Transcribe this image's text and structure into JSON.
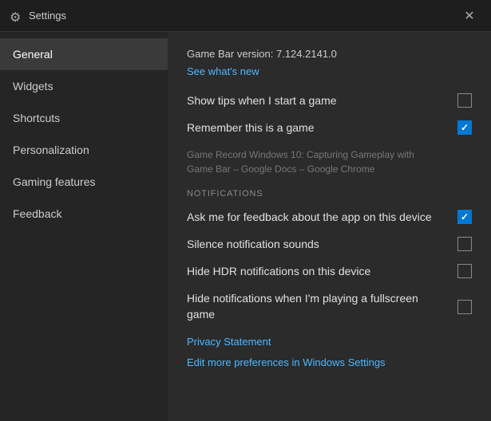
{
  "titleBar": {
    "icon": "⚙",
    "title": "Settings",
    "closeLabel": "✕"
  },
  "sidebar": {
    "items": [
      {
        "id": "general",
        "label": "General",
        "active": true
      },
      {
        "id": "widgets",
        "label": "Widgets",
        "active": false
      },
      {
        "id": "shortcuts",
        "label": "Shortcuts",
        "active": false
      },
      {
        "id": "personalization",
        "label": "Personalization",
        "active": false
      },
      {
        "id": "gaming-features",
        "label": "Gaming features",
        "active": false
      },
      {
        "id": "feedback",
        "label": "Feedback",
        "active": false
      }
    ]
  },
  "main": {
    "version": "Game Bar version: 7.124.2141.0",
    "seeWhatsNew": "See what's new",
    "settings": [
      {
        "id": "show-tips",
        "label": "Show tips when I start a game",
        "checked": false
      },
      {
        "id": "remember-game",
        "label": "Remember this is a game",
        "checked": true
      }
    ],
    "gameContext": "Game Record Windows 10: Capturing Gameplay with Game Bar – Google Docs – Google Chrome",
    "notificationsHeading": "NOTIFICATIONS",
    "notifications": [
      {
        "id": "ask-feedback",
        "label": "Ask me for feedback about the app on this device",
        "checked": true
      },
      {
        "id": "silence-sounds",
        "label": "Silence notification sounds",
        "checked": false
      },
      {
        "id": "hide-hdr",
        "label": "Hide HDR notifications on this device",
        "checked": false
      },
      {
        "id": "hide-fullscreen",
        "label": "Hide notifications when I'm playing a fullscreen game",
        "checked": false
      }
    ],
    "privacyStatement": "Privacy Statement",
    "editPreferences": "Edit more preferences in Windows Settings"
  }
}
